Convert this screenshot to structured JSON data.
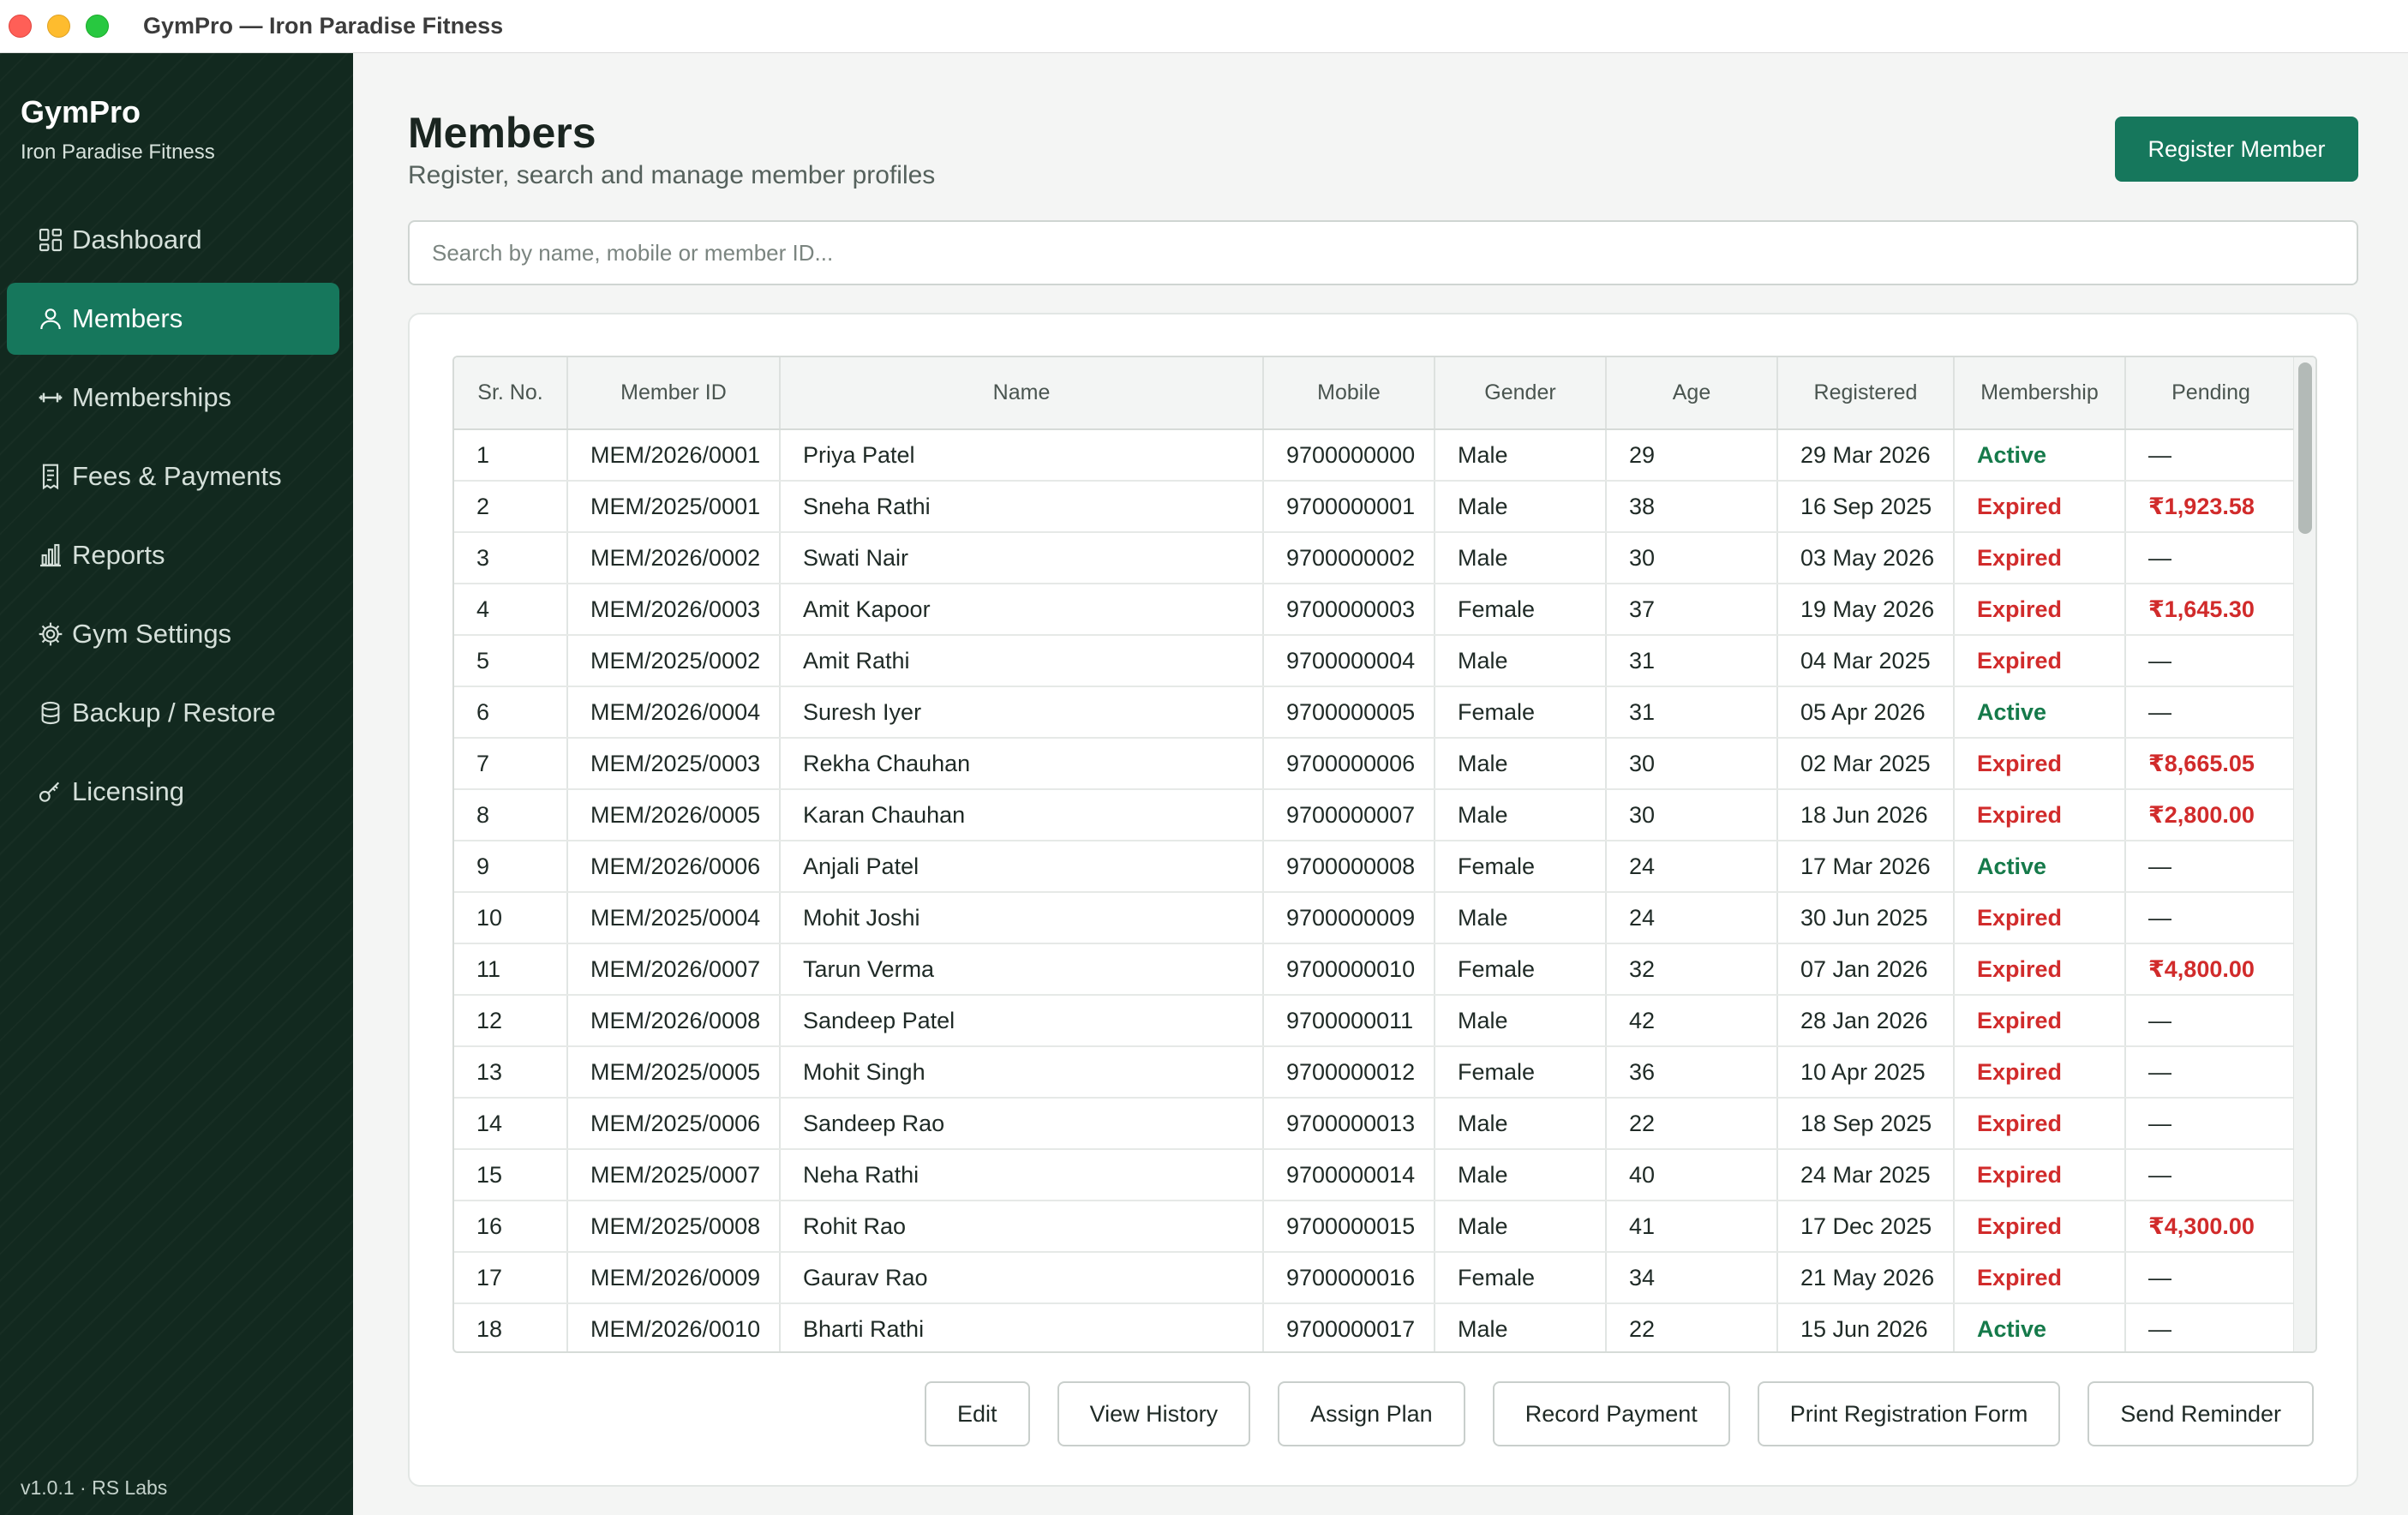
{
  "window": {
    "title": "GymPro — Iron Paradise Fitness"
  },
  "sidebar": {
    "brand": "GymPro",
    "subtitle": "Iron Paradise Fitness",
    "items": [
      {
        "label": "Dashboard",
        "icon": "dashboard-icon",
        "active": false
      },
      {
        "label": "Members",
        "icon": "user-icon",
        "active": true
      },
      {
        "label": "Memberships",
        "icon": "dumbbell-icon",
        "active": false
      },
      {
        "label": "Fees & Payments",
        "icon": "receipt-icon",
        "active": false
      },
      {
        "label": "Reports",
        "icon": "bar-chart-icon",
        "active": false
      },
      {
        "label": "Gym Settings",
        "icon": "gear-icon",
        "active": false
      },
      {
        "label": "Backup / Restore",
        "icon": "database-icon",
        "active": false
      },
      {
        "label": "Licensing",
        "icon": "key-icon",
        "active": false
      }
    ],
    "version": "v1.0.1 · RS Labs"
  },
  "header": {
    "title": "Members",
    "subtitle": "Register, search and manage member profiles",
    "register_label": "Register Member"
  },
  "search": {
    "placeholder": "Search by name, mobile or member ID...",
    "value": ""
  },
  "table": {
    "columns": [
      "Sr. No.",
      "Member ID",
      "Name",
      "Mobile",
      "Gender",
      "Age",
      "Registered",
      "Membership",
      "Pending"
    ],
    "rows": [
      [
        "1",
        "MEM/2026/0001",
        "Priya Patel",
        "9700000000",
        "Male",
        "29",
        "29 Mar 2026",
        "Active",
        "—"
      ],
      [
        "2",
        "MEM/2025/0001",
        "Sneha Rathi",
        "9700000001",
        "Male",
        "38",
        "16 Sep 2025",
        "Expired",
        "₹1,923.58"
      ],
      [
        "3",
        "MEM/2026/0002",
        "Swati Nair",
        "9700000002",
        "Male",
        "30",
        "03 May 2026",
        "Expired",
        "—"
      ],
      [
        "4",
        "MEM/2026/0003",
        "Amit Kapoor",
        "9700000003",
        "Female",
        "37",
        "19 May 2026",
        "Expired",
        "₹1,645.30"
      ],
      [
        "5",
        "MEM/2025/0002",
        "Amit Rathi",
        "9700000004",
        "Male",
        "31",
        "04 Mar 2025",
        "Expired",
        "—"
      ],
      [
        "6",
        "MEM/2026/0004",
        "Suresh Iyer",
        "9700000005",
        "Female",
        "31",
        "05 Apr 2026",
        "Active",
        "—"
      ],
      [
        "7",
        "MEM/2025/0003",
        "Rekha Chauhan",
        "9700000006",
        "Male",
        "30",
        "02 Mar 2025",
        "Expired",
        "₹8,665.05"
      ],
      [
        "8",
        "MEM/2026/0005",
        "Karan Chauhan",
        "9700000007",
        "Male",
        "30",
        "18 Jun 2026",
        "Expired",
        "₹2,800.00"
      ],
      [
        "9",
        "MEM/2026/0006",
        "Anjali Patel",
        "9700000008",
        "Female",
        "24",
        "17 Mar 2026",
        "Active",
        "—"
      ],
      [
        "10",
        "MEM/2025/0004",
        "Mohit Joshi",
        "9700000009",
        "Male",
        "24",
        "30 Jun 2025",
        "Expired",
        "—"
      ],
      [
        "11",
        "MEM/2026/0007",
        "Tarun Verma",
        "9700000010",
        "Female",
        "32",
        "07 Jan 2026",
        "Expired",
        "₹4,800.00"
      ],
      [
        "12",
        "MEM/2026/0008",
        "Sandeep Patel",
        "9700000011",
        "Male",
        "42",
        "28 Jan 2026",
        "Expired",
        "—"
      ],
      [
        "13",
        "MEM/2025/0005",
        "Mohit Singh",
        "9700000012",
        "Female",
        "36",
        "10 Apr 2025",
        "Expired",
        "—"
      ],
      [
        "14",
        "MEM/2025/0006",
        "Sandeep Rao",
        "9700000013",
        "Male",
        "22",
        "18 Sep 2025",
        "Expired",
        "—"
      ],
      [
        "15",
        "MEM/2025/0007",
        "Neha Rathi",
        "9700000014",
        "Male",
        "40",
        "24 Mar 2025",
        "Expired",
        "—"
      ],
      [
        "16",
        "MEM/2025/0008",
        "Rohit Rao",
        "9700000015",
        "Male",
        "41",
        "17 Dec 2025",
        "Expired",
        "₹4,300.00"
      ],
      [
        "17",
        "MEM/2026/0009",
        "Gaurav Rao",
        "9700000016",
        "Female",
        "34",
        "21 May 2026",
        "Expired",
        "—"
      ],
      [
        "18",
        "MEM/2026/0010",
        "Bharti Rathi",
        "9700000017",
        "Male",
        "22",
        "15 Jun 2026",
        "Active",
        "—"
      ]
    ]
  },
  "actions": [
    "Edit",
    "View History",
    "Assign Plan",
    "Record Payment",
    "Print Registration Form",
    "Send Reminder"
  ],
  "colors": {
    "sidebar_bg": "#12291f",
    "accent": "#16775c",
    "active_status": "#157a4a",
    "expired_status": "#d12b2b"
  }
}
